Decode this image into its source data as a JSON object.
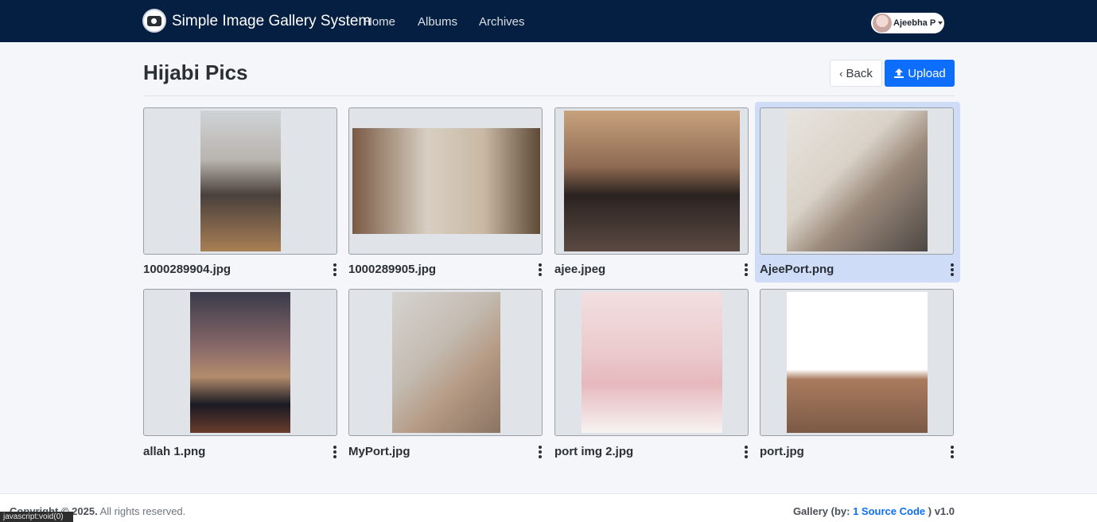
{
  "nav": {
    "brand": "Simple Image Gallery System",
    "links": [
      "Home",
      "Albums",
      "Archives"
    ],
    "user": "Ajeebha P"
  },
  "page": {
    "title": "Hijabi Pics",
    "back_label": "Back",
    "upload_label": "Upload"
  },
  "images": [
    {
      "name": "1000289904.jpg"
    },
    {
      "name": "1000289905.jpg"
    },
    {
      "name": "ajee.jpeg"
    },
    {
      "name": "AjeePort.png"
    },
    {
      "name": "allah 1.png"
    },
    {
      "name": "MyPort.jpg"
    },
    {
      "name": "port img 2.jpg"
    },
    {
      "name": "port.jpg"
    }
  ],
  "footer": {
    "copyright": "Copyright © 2025.",
    "rights": "All rights reserved.",
    "gallery_prefix": "Gallery (by:",
    "source_link": "1 Source Code",
    "gallery_suffix": ") v1.0"
  },
  "status_bar": "javascript:void(0)",
  "colors": {
    "navbar": "#051f42",
    "primary": "#0d6efd",
    "selected": "#cfdcf8"
  }
}
